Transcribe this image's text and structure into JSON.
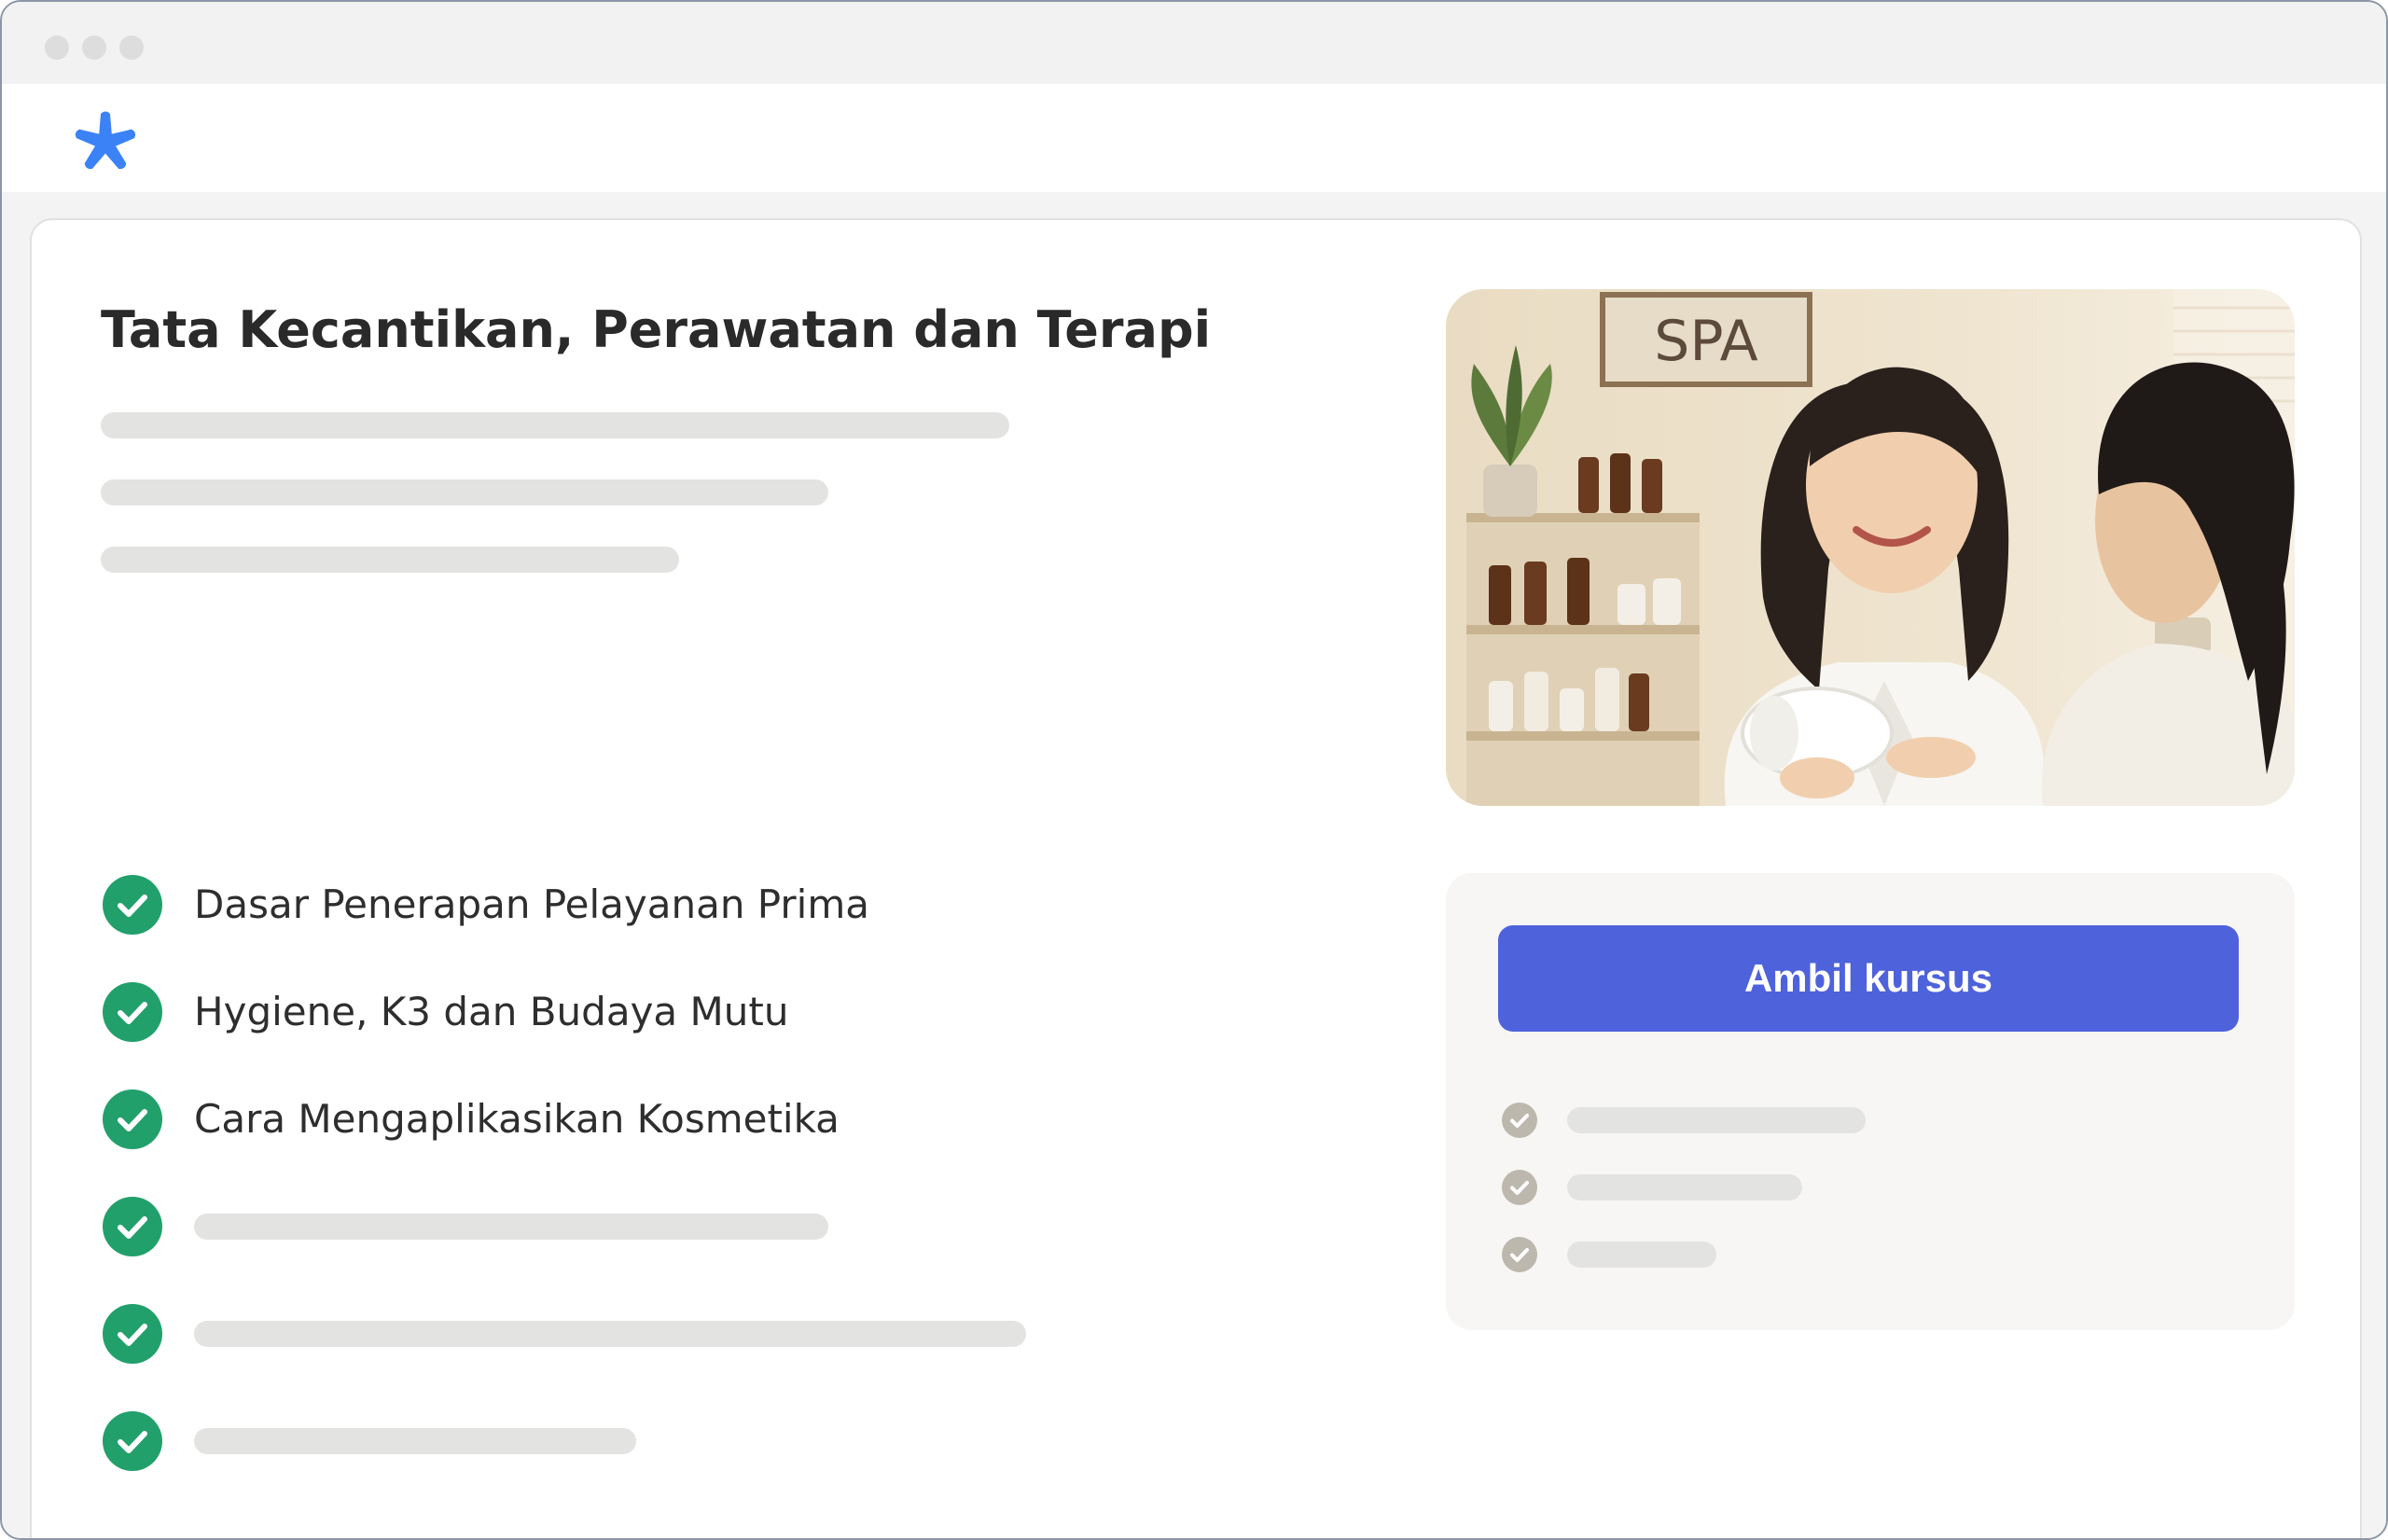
{
  "window": {
    "controls": [
      "close",
      "minimize",
      "maximize"
    ]
  },
  "app": {
    "logo_icon": "asterisk-icon",
    "logo_color": "#3b82f6"
  },
  "course": {
    "title": "Tata Kecantikan, Perawatan dan Terapi",
    "features": [
      {
        "label": "Dasar Penerapan Pelayanan Prima"
      },
      {
        "label": "Hygiene, K3 dan Budaya Mutu"
      },
      {
        "label": "Cara Mengaplikasikan Kosmetika"
      }
    ],
    "image_sign": "SPA",
    "cta_label": "Ambil kursus"
  },
  "colors": {
    "accent": "#4e62dc",
    "check_green": "#22a06b",
    "check_muted": "#bdb8ad",
    "placeholder": "#e3e3e1"
  }
}
